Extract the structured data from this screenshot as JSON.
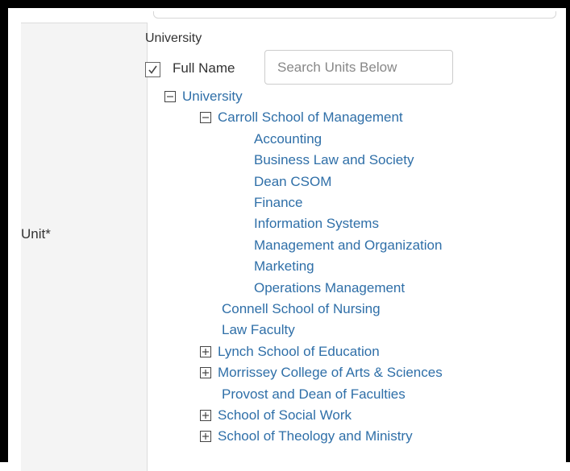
{
  "field": {
    "label": "Unit*",
    "selected_value": "University",
    "full_name_label": "Full Name",
    "full_name_checked": true,
    "search_placeholder": "Search Units Below",
    "search_value": ""
  },
  "tree": [
    {
      "id": "university",
      "label": "University",
      "depth": 0,
      "toggle": "collapse"
    },
    {
      "id": "carroll",
      "label": "Carroll School of Management",
      "depth": 1,
      "toggle": "collapse"
    },
    {
      "id": "accounting",
      "label": "Accounting",
      "depth": 2,
      "toggle": "none"
    },
    {
      "id": "business-law",
      "label": "Business Law and Society",
      "depth": 2,
      "toggle": "none"
    },
    {
      "id": "dean-csom",
      "label": "Dean CSOM",
      "depth": 2,
      "toggle": "none"
    },
    {
      "id": "finance",
      "label": "Finance",
      "depth": 2,
      "toggle": "none"
    },
    {
      "id": "info-systems",
      "label": "Information Systems",
      "depth": 2,
      "toggle": "none"
    },
    {
      "id": "mgmt-org",
      "label": "Management and Organization",
      "depth": 2,
      "toggle": "none"
    },
    {
      "id": "marketing",
      "label": "Marketing",
      "depth": 2,
      "toggle": "none"
    },
    {
      "id": "operations",
      "label": "Operations Management",
      "depth": 2,
      "toggle": "none"
    },
    {
      "id": "connell",
      "label": "Connell School of Nursing",
      "depth": 1,
      "toggle": "none"
    },
    {
      "id": "law",
      "label": "Law Faculty",
      "depth": 1,
      "toggle": "none"
    },
    {
      "id": "lynch",
      "label": "Lynch School of Education",
      "depth": 1,
      "toggle": "expand"
    },
    {
      "id": "morrissey",
      "label": "Morrissey College of Arts & Sciences",
      "depth": 1,
      "toggle": "expand"
    },
    {
      "id": "provost",
      "label": "Provost and Dean of Faculties",
      "depth": 1,
      "toggle": "none"
    },
    {
      "id": "social-work",
      "label": "School of Social Work",
      "depth": 1,
      "toggle": "expand"
    },
    {
      "id": "theology",
      "label": "School of Theology and Ministry",
      "depth": 1,
      "toggle": "expand"
    }
  ],
  "colors": {
    "link": "#2f6fa8",
    "label_bg": "#f4f4f4",
    "text": "#333333"
  }
}
